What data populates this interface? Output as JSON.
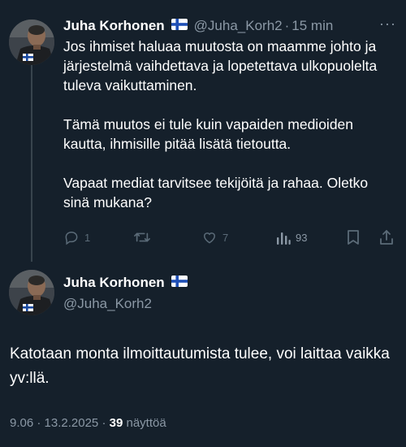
{
  "tweet": {
    "author_name": "Juha Korhonen",
    "author_handle": "@Juha_Korh2",
    "separator": "·",
    "time": "15 min",
    "more": "···",
    "paragraphs": [
      "Jos ihmiset haluaa muutosta on maamme johto ja järjestelmä vaihdettava ja lopetettava ulkopuolelta tuleva vaikuttaminen.",
      "Tämä muutos ei tule kuin  vapaiden medioiden kautta, ihmisille pitää lisätä tietoutta.",
      "Vapaat mediat tarvitsee tekijöitä ja rahaa. Oletko sinä mukana?"
    ],
    "reply_count": "1",
    "retweet_count": "",
    "like_count": "7",
    "view_count": "93"
  },
  "reply": {
    "author_name": "Juha Korhonen",
    "author_handle": "@Juha_Korh2",
    "text": "Katotaan monta ilmoittautumista tulee, voi laittaa vaikka yv:llä.",
    "time": "9.06",
    "separator": "·",
    "date": "13.2.2025",
    "views_number": "39",
    "views_label": "näyttöä"
  },
  "colors": {
    "background": "#15202b",
    "secondary_text": "#8b98a5",
    "icon": "#5b6b78",
    "thread_line": "#38444d"
  },
  "icons": {
    "reply": "reply-icon",
    "retweet": "retweet-icon",
    "like": "heart-icon",
    "views": "views-icon",
    "bookmark": "bookmark-icon",
    "share": "share-icon",
    "flag": "finland-flag-icon"
  }
}
